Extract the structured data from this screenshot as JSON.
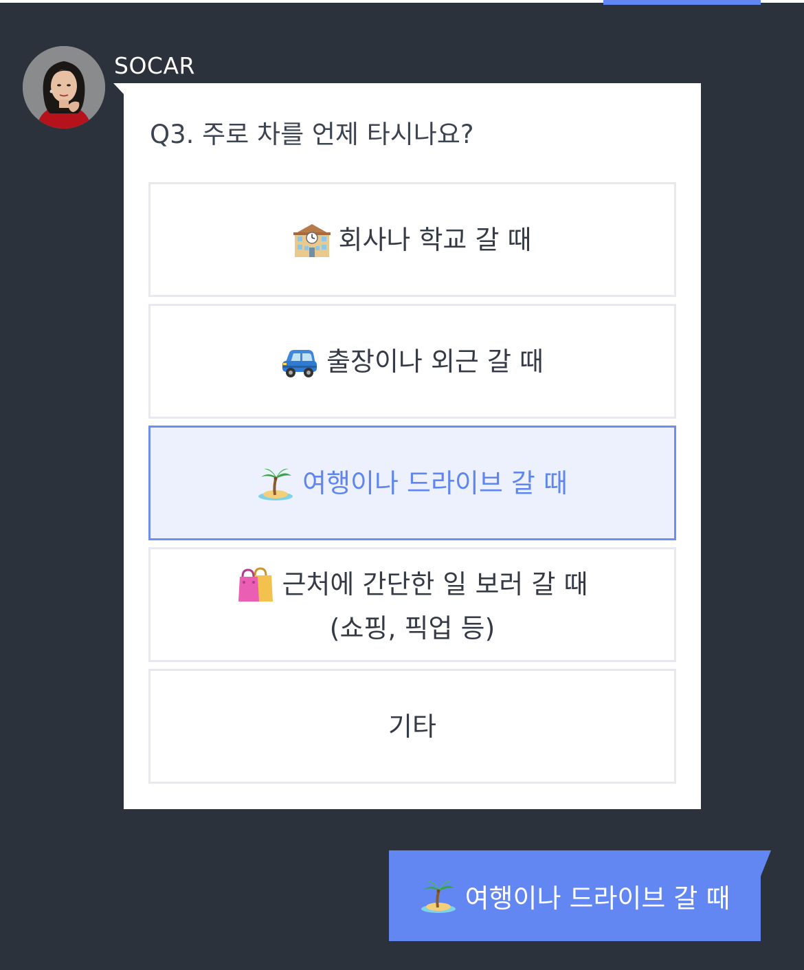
{
  "sender": {
    "name": "SOCAR",
    "avatar_icon": "profile-photo"
  },
  "question": {
    "title": "Q3. 주로 차를 언제 타시나요?",
    "options": [
      {
        "icon": "school-building-icon",
        "lines": [
          "회사나 학교 갈 때"
        ],
        "selected": false
      },
      {
        "icon": "car-icon",
        "lines": [
          "출장이나 외근 갈 때"
        ],
        "selected": false
      },
      {
        "icon": "desert-island-icon",
        "lines": [
          "여행이나 드라이브 갈 때"
        ],
        "selected": true
      },
      {
        "icon": "shopping-bags-icon",
        "lines": [
          "근처에 간단한 일 보러 갈 때",
          "(쇼핑, 픽업 등)"
        ],
        "selected": false
      },
      {
        "icon": "",
        "lines": [
          "기타"
        ],
        "selected": false
      }
    ]
  },
  "answer": {
    "icon": "desert-island-icon",
    "text": "여행이나 드라이브 갈 때"
  },
  "colors": {
    "background": "#2b323c",
    "accent": "#6387f2",
    "selected_fill": "#ecf1fd",
    "selected_text": "#5f86ef",
    "option_border": "#e7e9ee"
  }
}
